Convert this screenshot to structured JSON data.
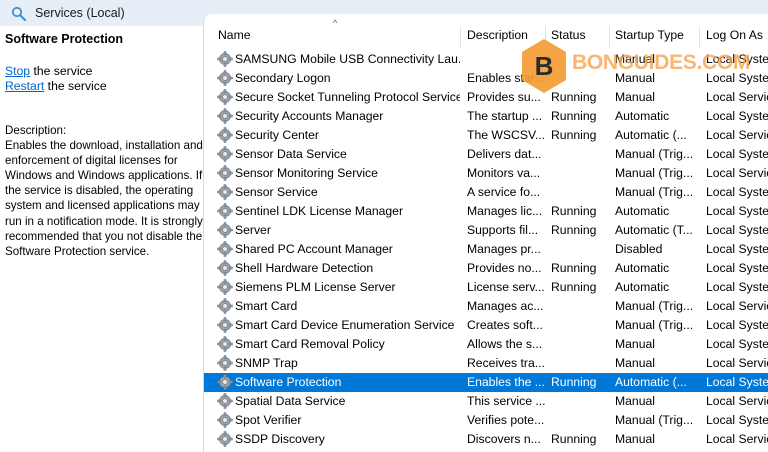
{
  "window": {
    "title": "Services (Local)"
  },
  "left_pane": {
    "service_name": "Software Protection",
    "stop_link": "Stop",
    "stop_suffix": " the service",
    "restart_link": "Restart",
    "restart_suffix": " the service",
    "description_label": "Description:",
    "description_text": "Enables the download, installation and enforcement of digital licenses for Windows and Windows applications. If the service is disabled, the operating system and licensed applications may run in a notification mode. It is strongly recommended that you not disable the Software Protection service."
  },
  "columns": {
    "name": "Name",
    "description": "Description",
    "status": "Status",
    "startup_type": "Startup Type",
    "log_on_as": "Log On As"
  },
  "services": [
    {
      "name": "SAMSUNG Mobile USB Connectivity Lau...",
      "description": "",
      "status": "",
      "startup": "Manual",
      "logon": "Local Syste..."
    },
    {
      "name": "Secondary Logon",
      "description": "Enables star...",
      "status": "",
      "startup": "Manual",
      "logon": "Local Syste..."
    },
    {
      "name": "Secure Socket Tunneling Protocol Service",
      "description": "Provides su...",
      "status": "Running",
      "startup": "Manual",
      "logon": "Local Servic"
    },
    {
      "name": "Security Accounts Manager",
      "description": "The startup ...",
      "status": "Running",
      "startup": "Automatic",
      "logon": "Local Syste..."
    },
    {
      "name": "Security Center",
      "description": "The WSCSV...",
      "status": "Running",
      "startup": "Automatic (...",
      "logon": "Local Servic"
    },
    {
      "name": "Sensor Data Service",
      "description": "Delivers dat...",
      "status": "",
      "startup": "Manual (Trig...",
      "logon": "Local Syste..."
    },
    {
      "name": "Sensor Monitoring Service",
      "description": "Monitors va...",
      "status": "",
      "startup": "Manual (Trig...",
      "logon": "Local Servic"
    },
    {
      "name": "Sensor Service",
      "description": "A service fo...",
      "status": "",
      "startup": "Manual (Trig...",
      "logon": "Local Syste..."
    },
    {
      "name": "Sentinel LDK License Manager",
      "description": "Manages lic...",
      "status": "Running",
      "startup": "Automatic",
      "logon": "Local Syste..."
    },
    {
      "name": "Server",
      "description": "Supports fil...",
      "status": "Running",
      "startup": "Automatic (T...",
      "logon": "Local Syste..."
    },
    {
      "name": "Shared PC Account Manager",
      "description": "Manages pr...",
      "status": "",
      "startup": "Disabled",
      "logon": "Local Syste..."
    },
    {
      "name": "Shell Hardware Detection",
      "description": "Provides no...",
      "status": "Running",
      "startup": "Automatic",
      "logon": "Local Syste..."
    },
    {
      "name": "Siemens PLM License Server",
      "description": "License serv...",
      "status": "Running",
      "startup": "Automatic",
      "logon": "Local Syste..."
    },
    {
      "name": "Smart Card",
      "description": "Manages ac...",
      "status": "",
      "startup": "Manual (Trig...",
      "logon": "Local Servic"
    },
    {
      "name": "Smart Card Device Enumeration Service",
      "description": "Creates soft...",
      "status": "",
      "startup": "Manual (Trig...",
      "logon": "Local Syste..."
    },
    {
      "name": "Smart Card Removal Policy",
      "description": "Allows the s...",
      "status": "",
      "startup": "Manual",
      "logon": "Local Syste..."
    },
    {
      "name": "SNMP Trap",
      "description": "Receives tra...",
      "status": "",
      "startup": "Manual",
      "logon": "Local Servic"
    },
    {
      "name": "Software Protection",
      "description": "Enables the ...",
      "status": "Running",
      "startup": "Automatic (...",
      "logon": "Local Syste...",
      "selected": true
    },
    {
      "name": "Spatial Data Service",
      "description": "This service ...",
      "status": "",
      "startup": "Manual",
      "logon": "Local Servic"
    },
    {
      "name": "Spot Verifier",
      "description": "Verifies pote...",
      "status": "",
      "startup": "Manual (Trig...",
      "logon": "Local Syste..."
    },
    {
      "name": "SSDP Discovery",
      "description": "Discovers n...",
      "status": "Running",
      "startup": "Manual",
      "logon": "Local Servic"
    }
  ],
  "watermark": {
    "text": "BONGUIDES.COM",
    "letter": "B"
  },
  "colors": {
    "selection": "#0078d7",
    "link": "#0066cc",
    "titlebar": "#e6eef7",
    "watermark": "#f6a24a"
  }
}
